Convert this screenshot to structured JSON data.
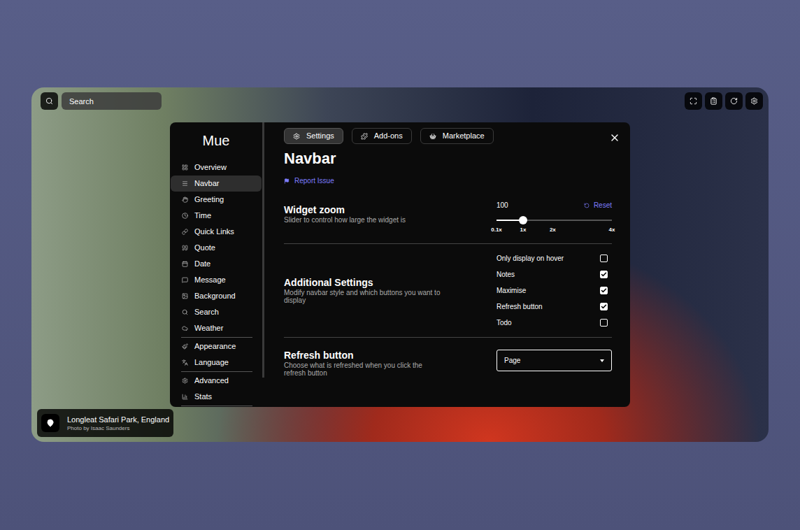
{
  "search": {
    "placeholder": "Search"
  },
  "sidebar": {
    "title": "Mue",
    "groups": [
      [
        {
          "label": "Overview",
          "selected": false
        },
        {
          "label": "Navbar",
          "selected": true
        },
        {
          "label": "Greeting",
          "selected": false
        },
        {
          "label": "Time",
          "selected": false
        },
        {
          "label": "Quick Links",
          "selected": false
        },
        {
          "label": "Quote",
          "selected": false
        },
        {
          "label": "Date",
          "selected": false
        },
        {
          "label": "Message",
          "selected": false
        },
        {
          "label": "Background",
          "selected": false
        },
        {
          "label": "Search",
          "selected": false
        },
        {
          "label": "Weather",
          "selected": false
        }
      ],
      [
        {
          "label": "Appearance",
          "selected": false
        },
        {
          "label": "Language",
          "selected": false
        }
      ],
      [
        {
          "label": "Advanced",
          "selected": false
        },
        {
          "label": "Stats",
          "selected": false
        }
      ]
    ]
  },
  "tabs": [
    {
      "label": "Settings",
      "selected": true
    },
    {
      "label": "Add-ons",
      "selected": false
    },
    {
      "label": "Marketplace",
      "selected": false
    }
  ],
  "page": {
    "title": "Navbar",
    "report": "Report Issue"
  },
  "zoom": {
    "title": "Widget zoom",
    "description": "Slider to control how large the widget is",
    "value": "100",
    "reset": "Reset",
    "level": 0.23,
    "ticks": [
      {
        "label": "0.1x",
        "value": 0.1
      },
      {
        "label": "1x",
        "value": 1
      },
      {
        "label": "2x",
        "value": 2
      },
      {
        "label": "4x",
        "value": 4
      }
    ]
  },
  "additional": {
    "title": "Additional Settings",
    "description": "Modify navbar style and which buttons you want to display",
    "options": [
      {
        "label": "Only display on hover",
        "checked": false
      },
      {
        "label": "Notes",
        "checked": true
      },
      {
        "label": "Maximise",
        "checked": true
      },
      {
        "label": "Refresh button",
        "checked": true
      },
      {
        "label": "Todo",
        "checked": false
      }
    ]
  },
  "refresh": {
    "title": "Refresh button",
    "description": "Choose what is refreshed when you click the refresh button",
    "value": "Page"
  },
  "location": {
    "title": "Longleat Safari Park, England",
    "credit": "Photo by Isaac Saunders"
  }
}
